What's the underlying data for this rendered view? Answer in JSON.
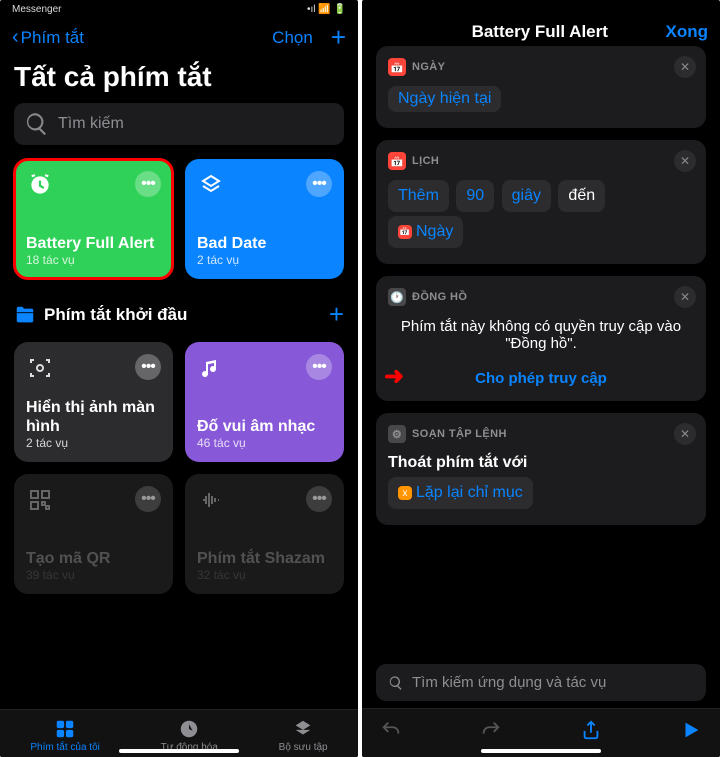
{
  "left": {
    "status": "Messenger",
    "back": "Phím tắt",
    "select": "Chọn",
    "title": "Tất cả phím tắt",
    "search_placeholder": "Tìm kiếm",
    "cards": [
      {
        "title": "Battery Full Alert",
        "sub": "18 tác vụ"
      },
      {
        "title": "Bad Date",
        "sub": "2 tác vụ"
      }
    ],
    "section": "Phím tắt khởi đầu",
    "starters": [
      {
        "title": "Hiển thị ảnh màn hình",
        "sub": "2 tác vụ"
      },
      {
        "title": "Đố vui âm nhạc",
        "sub": "46 tác vụ"
      },
      {
        "title": "Tạo mã QR",
        "sub": "39 tác vụ"
      },
      {
        "title": "Phím tắt Shazam",
        "sub": "32 tác vụ"
      }
    ],
    "tabs": [
      "Phím tắt của tôi",
      "Tự động hóa",
      "Bộ sưu tập"
    ]
  },
  "right": {
    "title": "Battery Full Alert",
    "done": "Xong",
    "a1": {
      "h": "NGÀY",
      "body": "Ngày hiện tại"
    },
    "a2": {
      "h": "LỊCH",
      "t1": "Thêm",
      "t2": "90",
      "t3": "giây",
      "t4": "đến",
      "t5": "Ngày"
    },
    "a3": {
      "h": "ĐỒNG HỒ",
      "msg": "Phím tắt này không có quyền truy cập vào \"Đồng hồ\".",
      "allow": "Cho phép truy cập"
    },
    "a4": {
      "h": "SOẠN TẬP LỆNH",
      "t1": "Thoát phím tắt với",
      "t2": "Lặp lại chỉ mục"
    },
    "search": "Tìm kiếm ứng dụng và tác vụ"
  }
}
